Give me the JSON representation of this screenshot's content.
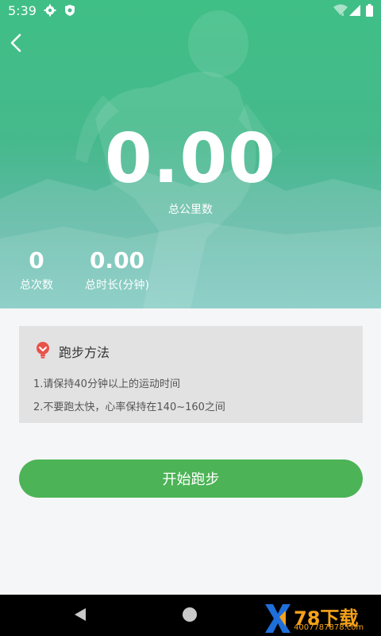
{
  "status_bar": {
    "time": "5:39",
    "icons": [
      "gear-icon",
      "shield-icon",
      "wifi-icon",
      "signal-icon",
      "battery-icon"
    ]
  },
  "hero": {
    "total_km": "0.00",
    "total_km_label": "总公里数",
    "total_count": "0",
    "total_count_label": "总次数",
    "total_duration": "0.00",
    "total_duration_label": "总时长(分钟)"
  },
  "tips": {
    "title": "跑步方法",
    "lines": [
      "1.请保持40分钟以上的运动时间",
      "2.不要跑太快，心率保持在140~160之间"
    ]
  },
  "action": {
    "start_label": "开始跑步"
  },
  "watermark": {
    "brand": "78下载",
    "site": "4007787878.com"
  },
  "colors": {
    "hero_green": "#3fbf86",
    "button_green": "#4cb356",
    "card_bg": "#e2e2e2",
    "tip_icon_red": "#e8534a",
    "watermark_orange": "#f5a21b"
  }
}
